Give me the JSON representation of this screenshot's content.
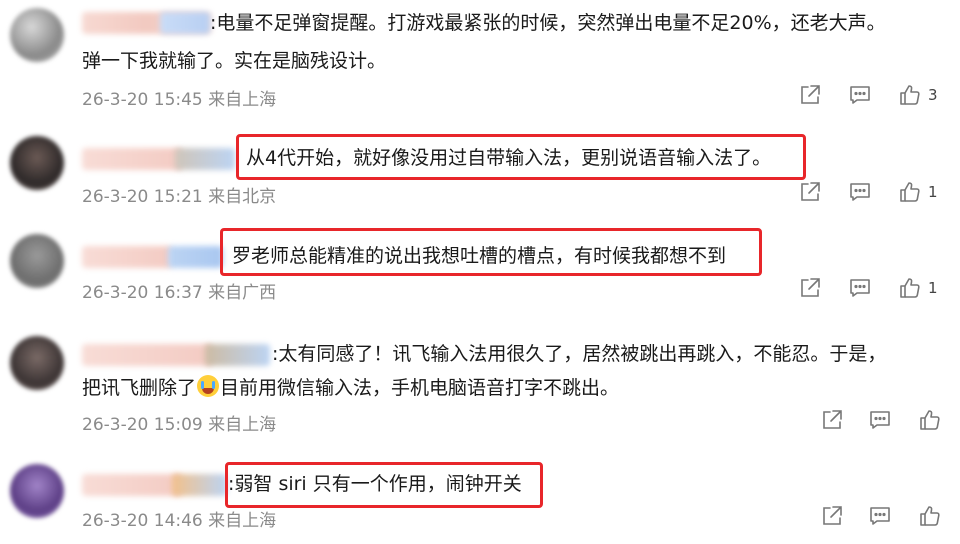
{
  "comments": [
    {
      "text_lines": [
        ":电量不足弹窗提醒。打游戏最紧张的时候，突然弹出电量不足20%，还老大声。",
        "弹一下我就输了。实在是脑残设计。"
      ],
      "time": "26-3-20 15:45",
      "location": "来自上海",
      "likes": "3"
    },
    {
      "text_lines": [
        "从4代开始，就好像没用过自带输入法，更别说语音输入法了。"
      ],
      "time": "26-3-20 15:21",
      "location": "来自北京",
      "likes": "1"
    },
    {
      "text_lines": [
        "罗老师总能精准的说出我想吐槽的槽点，有时候我都想不到"
      ],
      "time": "26-3-20 16:37",
      "location": "来自广西",
      "likes": "1"
    },
    {
      "text_lines": [
        ":太有同感了！讯飞输入法用很久了，居然被跳出再跳入，不能忍。于是，",
        "把讯飞删除了",
        "目前用微信输入法，手机电脑语音打字不跳出。"
      ],
      "time": "26-3-20 15:09",
      "location": "来自上海",
      "likes": ""
    },
    {
      "text_lines": [
        ":弱智 siri 只有一个作用，闹钟开关"
      ],
      "time": "26-3-20 14:46",
      "location": "来自上海",
      "likes": ""
    }
  ],
  "icons": {
    "share": "share-icon",
    "comment": "comment-icon",
    "like": "thumbs-up-icon",
    "emoji": "crying-laughing-emoji"
  },
  "colors": {
    "highlight_box": "#e8262a",
    "meta_text": "#8a8a8a"
  }
}
